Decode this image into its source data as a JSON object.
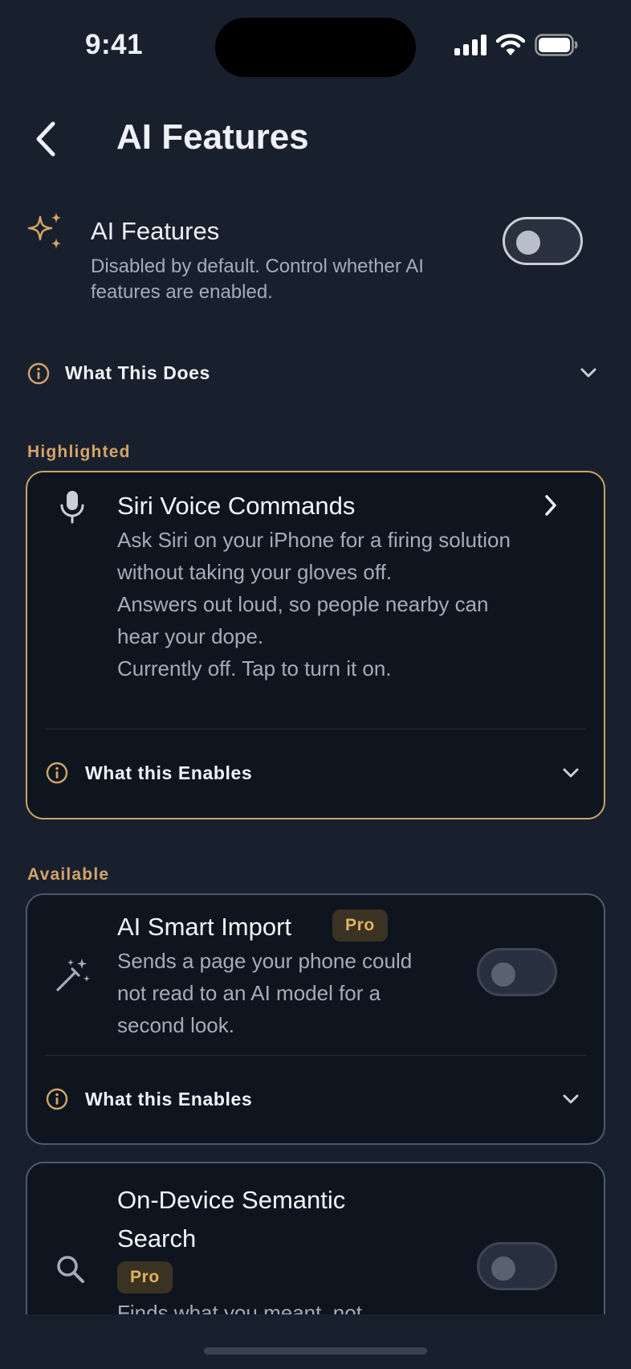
{
  "status": {
    "time": "9:41"
  },
  "header": {
    "title": "AI Features"
  },
  "ai_toggle": {
    "title": "AI Features",
    "description": "Disabled by default. Control whether AI features are enabled.",
    "enabled": false
  },
  "what_this_does": {
    "label": "What This Does"
  },
  "highlighted": {
    "section_label": "Highlighted",
    "card": {
      "icon": "microphone-icon",
      "title": "Siri Voice Commands",
      "desc_line1": "Ask Siri on your iPhone for a firing solution without taking your gloves off.",
      "desc_line2": "Answers out loud, so people nearby can hear your dope.",
      "desc_line3": "Currently off. Tap to turn it on.",
      "enables_label": "What this Enables"
    }
  },
  "available": {
    "section_label": "Available",
    "cards": [
      {
        "icon": "magic-wand-icon",
        "title": "AI Smart Import",
        "badge": "Pro",
        "description": "Sends a page your phone could not read to an AI model for a second look.",
        "enabled": false,
        "enables_label": "What this Enables"
      },
      {
        "icon": "search-icon",
        "title": "On-Device Semantic Search",
        "badge": "Pro",
        "description": "Finds what you meant, not",
        "enabled": false
      }
    ]
  },
  "colors": {
    "background": "#19202d",
    "card_background": "#0f151f",
    "accent_gold": "#d3a468",
    "highlight_border": "#c9a56a",
    "card_border": "#4a5a70"
  }
}
